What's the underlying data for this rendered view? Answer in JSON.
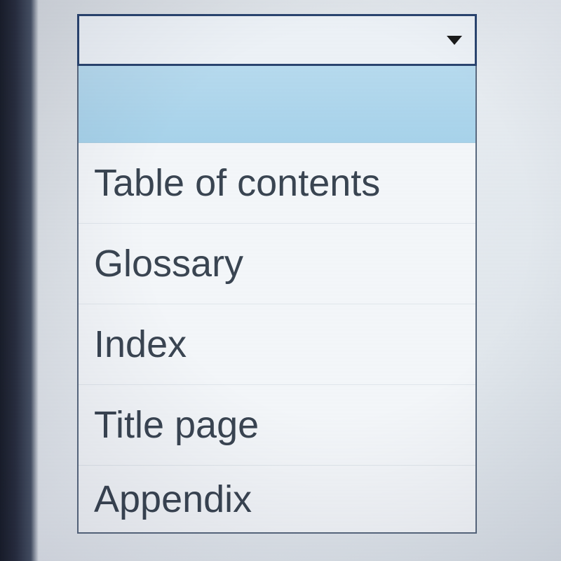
{
  "dropdown": {
    "selected_value": "",
    "options": [
      {
        "label": "",
        "highlighted": true
      },
      {
        "label": "Table of contents",
        "highlighted": false
      },
      {
        "label": "Glossary",
        "highlighted": false
      },
      {
        "label": "Index",
        "highlighted": false
      },
      {
        "label": "Title page",
        "highlighted": false
      },
      {
        "label": "Appendix",
        "highlighted": false
      }
    ]
  }
}
